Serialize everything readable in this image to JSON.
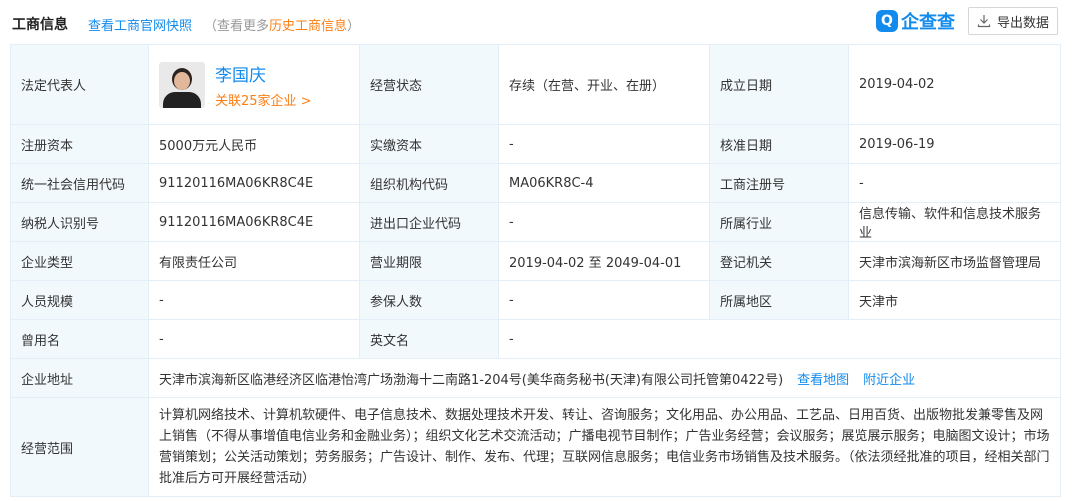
{
  "header": {
    "title": "工商信息",
    "snapshot_link": "查看工商官网快照",
    "more_prefix": "（查看更多",
    "more_highlight": "历史工商信息",
    "more_suffix": "）",
    "logo_mark": "Q",
    "logo_text": "企查查",
    "export_label": "导出数据"
  },
  "rows": {
    "legal_rep_label": "法定代表人",
    "legal_rep_name": "李国庆",
    "legal_rep_related": "关联25家企业 >",
    "status_label": "经营状态",
    "status_value": "存续（在营、开业、在册）",
    "founded_label": "成立日期",
    "founded_value": "2019-04-02",
    "reg_capital_label": "注册资本",
    "reg_capital_value": "5000万元人民币",
    "paid_capital_label": "实缴资本",
    "paid_capital_value": "-",
    "approve_label": "核准日期",
    "approve_value": "2019-06-19",
    "credit_code_label": "统一社会信用代码",
    "credit_code_value": "91120116MA06KR8C4E",
    "org_code_label": "组织机构代码",
    "org_code_value": "MA06KR8C-4",
    "biz_reg_label": "工商注册号",
    "biz_reg_value": "-",
    "taxpayer_label": "纳税人识别号",
    "taxpayer_value": "91120116MA06KR8C4E",
    "import_export_label": "进出口企业代码",
    "import_export_value": "-",
    "industry_label": "所属行业",
    "industry_value": "信息传输、软件和信息技术服务业",
    "type_label": "企业类型",
    "type_value": "有限责任公司",
    "term_label": "营业期限",
    "term_value": "2019-04-02 至 2049-04-01",
    "authority_label": "登记机关",
    "authority_value": "天津市滨海新区市场监督管理局",
    "staff_label": "人员规模",
    "staff_value": "-",
    "insured_label": "参保人数",
    "insured_value": "-",
    "region_label": "所属地区",
    "region_value": "天津市",
    "former_name_label": "曾用名",
    "former_name_value": "-",
    "english_name_label": "英文名",
    "english_name_value": "-",
    "address_label": "企业地址",
    "address_value": "天津市滨海新区临港经济区临港怡湾广场渤海十二南路1-204号(美华商务秘书(天津)有限公司托管第0422号)",
    "map_link": "查看地图",
    "nearby_link": "附近企业",
    "scope_label": "经营范围",
    "scope_value": "计算机网络技术、计算机软硬件、电子信息技术、数据处理技术开发、转让、咨询服务；文化用品、办公用品、工艺品、日用百货、出版物批发兼零售及网上销售（不得从事增值电信业务和金融业务）；组织文化艺术交流活动；广播电视节目制作；广告业务经营；会议服务；展览展示服务；电脑图文设计；市场营销策划；公关活动策划；劳务服务；广告设计、制作、发布、代理；互联网信息服务；电信业务市场销售及技术服务。（依法须经批准的项目，经相关部门批准后方可开展经营活动）"
  }
}
